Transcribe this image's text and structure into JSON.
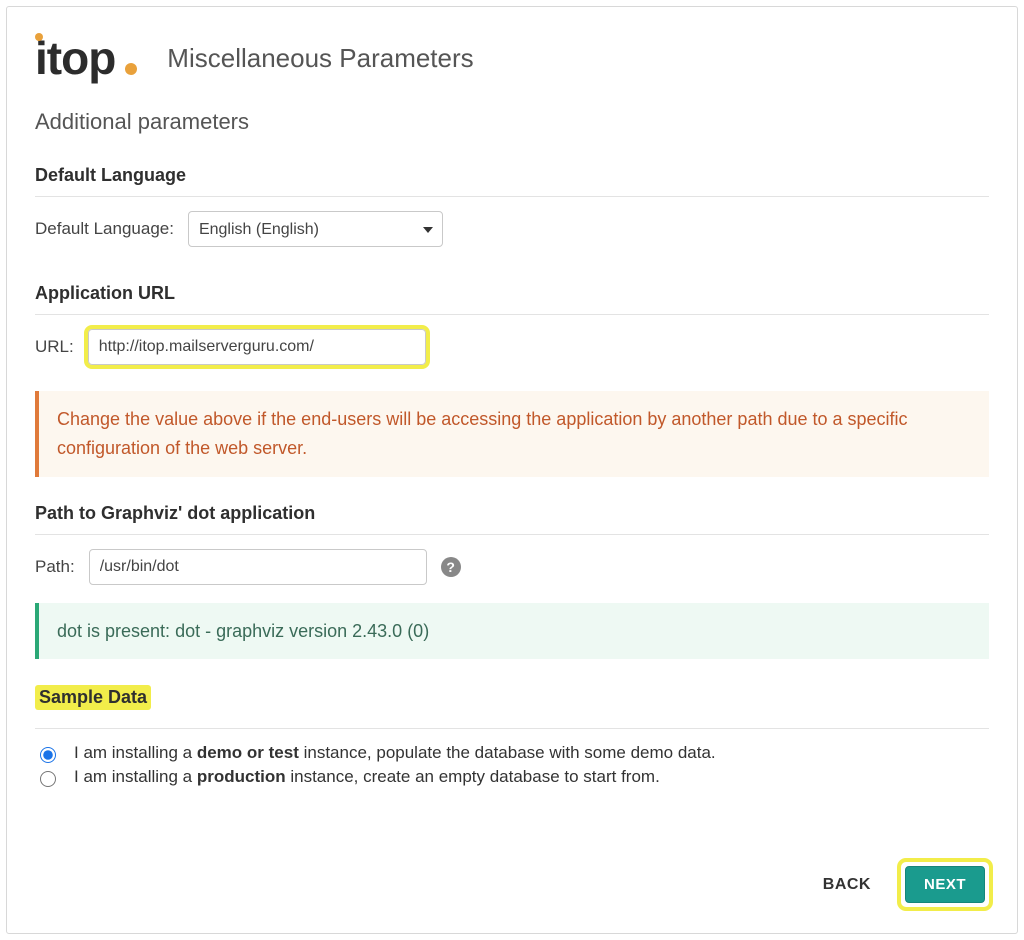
{
  "logo_text": "itop",
  "page_title": "Miscellaneous Parameters",
  "subtitle": "Additional parameters",
  "sections": {
    "language": {
      "heading": "Default Language",
      "label": "Default Language:",
      "selected": "English (English)"
    },
    "app_url": {
      "heading": "Application URL",
      "label": "URL:",
      "value": "http://itop.mailserverguru.com/",
      "warning": "Change the value above if the end-users will be accessing the application by another path due to a specific configuration of the web server."
    },
    "graphviz": {
      "heading": "Path to Graphviz' dot application",
      "label": "Path:",
      "value": "/usr/bin/dot",
      "success": "dot is present: dot - graphviz version 2.43.0 (0)"
    },
    "sample_data": {
      "heading": "Sample Data",
      "options": {
        "demo": {
          "prefix": "I am installing a ",
          "bold": "demo or test",
          "suffix": " instance, populate the database with some demo data."
        },
        "prod": {
          "prefix": "I am installing a ",
          "bold": "production",
          "suffix": " instance, create an empty database to start from."
        }
      }
    }
  },
  "footer": {
    "back": "BACK",
    "next": "NEXT"
  },
  "icons": {
    "help": "?"
  }
}
